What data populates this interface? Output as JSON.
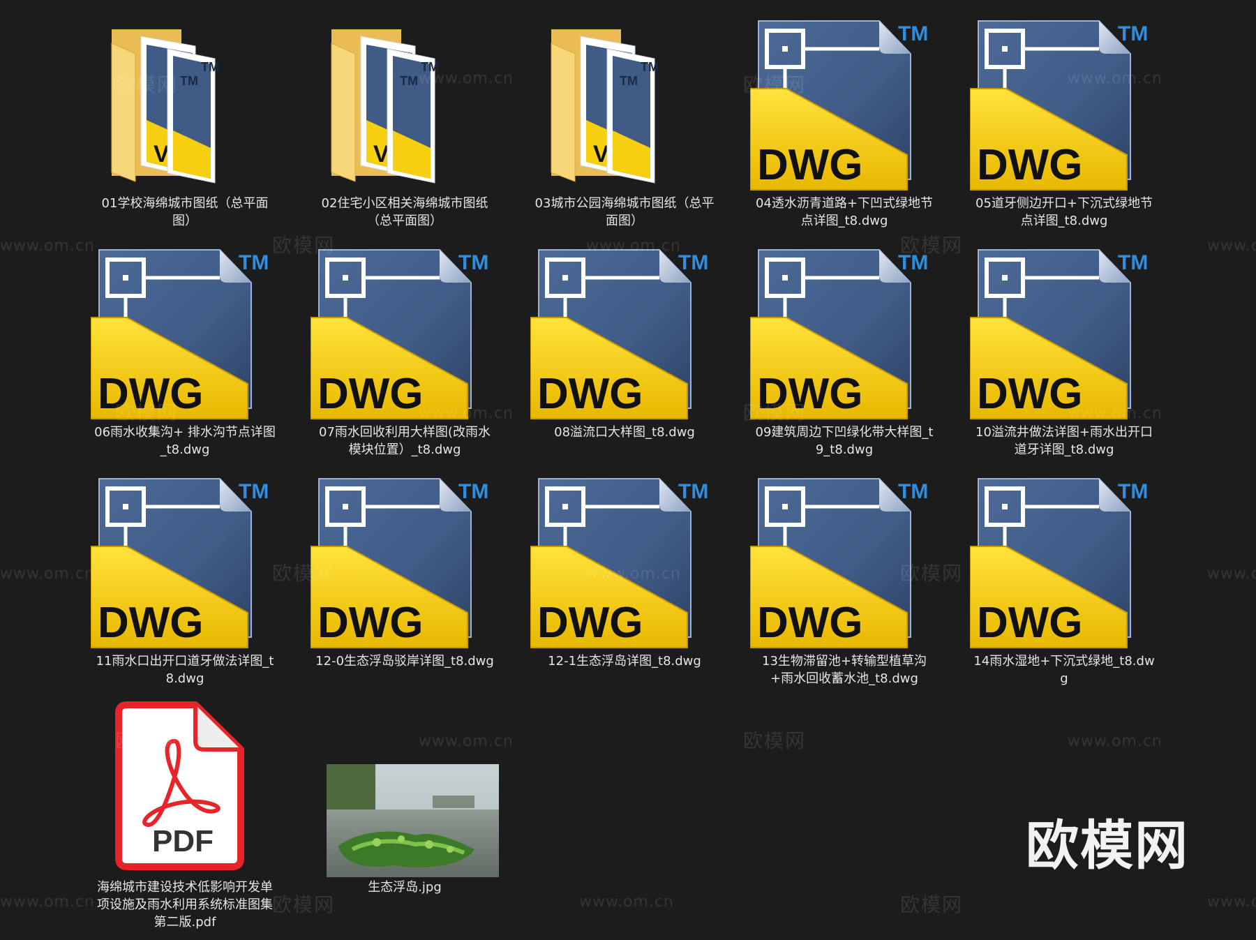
{
  "window": {
    "background": "#1c1c1c",
    "label_color": "#e6e6e6"
  },
  "files": [
    {
      "name": "01学校海绵城市图纸（总平面图）",
      "type": "folder",
      "icon": "folder-dwg-icon"
    },
    {
      "name": "02住宅小区相关海绵城市图纸（总平面图）",
      "type": "folder",
      "icon": "folder-dwg-icon"
    },
    {
      "name": "03城市公园海绵城市图纸（总平面图）",
      "type": "folder",
      "icon": "folder-dwg-icon"
    },
    {
      "name": "04透水沥青道路+下凹式绿地节点详图_t8.dwg",
      "type": "dwg",
      "icon": "dwg-file-icon"
    },
    {
      "name": "05道牙侧边开口+下沉式绿地节点详图_t8.dwg",
      "type": "dwg",
      "icon": "dwg-file-icon"
    },
    {
      "name": "06雨水收集沟+ 排水沟节点详图_t8.dwg",
      "type": "dwg",
      "icon": "dwg-file-icon"
    },
    {
      "name": "07雨水回收利用大样图(改雨水模块位置）_t8.dwg",
      "type": "dwg",
      "icon": "dwg-file-icon"
    },
    {
      "name": "08溢流口大样图_t8.dwg",
      "type": "dwg",
      "icon": "dwg-file-icon"
    },
    {
      "name": "09建筑周边下凹绿化带大样图_t9_t8.dwg",
      "type": "dwg",
      "icon": "dwg-file-icon"
    },
    {
      "name": "10溢流井做法详图+雨水出开口道牙详图_t8.dwg",
      "type": "dwg",
      "icon": "dwg-file-icon"
    },
    {
      "name": "11雨水口出开口道牙做法详图_t8.dwg",
      "type": "dwg",
      "icon": "dwg-file-icon"
    },
    {
      "name": "12-0生态浮岛驳岸详图_t8.dwg",
      "type": "dwg",
      "icon": "dwg-file-icon"
    },
    {
      "name": "12-1生态浮岛详图_t8.dwg",
      "type": "dwg",
      "icon": "dwg-file-icon"
    },
    {
      "name": "13生物滞留池+转输型植草沟+雨水回收蓄水池_t8.dwg",
      "type": "dwg",
      "icon": "dwg-file-icon"
    },
    {
      "name": "14雨水湿地+下沉式绿地_t8.dwg",
      "type": "dwg",
      "icon": "dwg-file-icon"
    },
    {
      "name": "海绵城市建设技术低影响开发单项设施及雨水利用系统标准图集第二版.pdf",
      "type": "pdf",
      "icon": "pdf-file-icon"
    },
    {
      "name": "生态浮岛.jpg",
      "type": "image",
      "icon": "jpg-thumbnail"
    }
  ],
  "icon_text": {
    "dwg": "DWG",
    "tm": "TM",
    "pdf": "PDF"
  },
  "colors": {
    "dwg_yellow": "#f5cf10",
    "dwg_blue": "#3f5b86",
    "tm_blue": "#2f8ee0",
    "folder_yellow": "#f3cf6a",
    "pdf_red": "#e8242b"
  },
  "watermark": {
    "logo": "欧模网",
    "url": "www.om.cn"
  }
}
